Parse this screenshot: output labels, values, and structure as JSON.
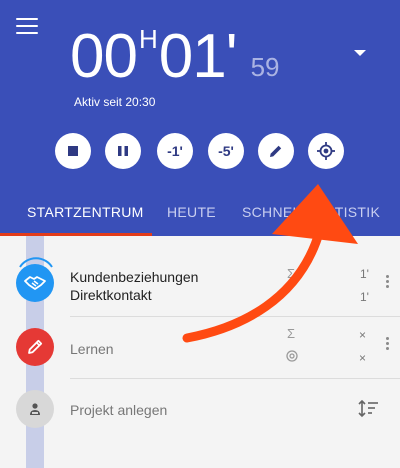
{
  "header": {
    "timer": {
      "hours": "00",
      "hour_unit": "H",
      "minutes": "01'",
      "seconds": "59"
    },
    "active_since": "Aktiv seit 20:30",
    "controls": {
      "minus_one": "-1'",
      "minus_five": "-5'"
    },
    "tabs": [
      "STARTZENTRUM",
      "HEUTE",
      "SCHNELLSTATISTIK"
    ]
  },
  "list": {
    "items": [
      {
        "title_line1": "Kundenbeziehungen",
        "title_line2": "Direktkontakt",
        "stat_top": "1'",
        "stat_bottom": "1'",
        "icon": "handshake-icon",
        "color": "#2196f3"
      },
      {
        "title": "Lernen",
        "stat_top": "×",
        "stat_bottom": "×",
        "icon": "pencil-icon",
        "color": "#e53935"
      },
      {
        "title": "Projekt anlegen",
        "icon": "project-icon",
        "color": "#d8d8d8"
      }
    ]
  },
  "colors": {
    "header_bg": "#3a4fb8",
    "tab_indicator": "#e23c1a",
    "annotation_arrow": "#ff4a12"
  }
}
